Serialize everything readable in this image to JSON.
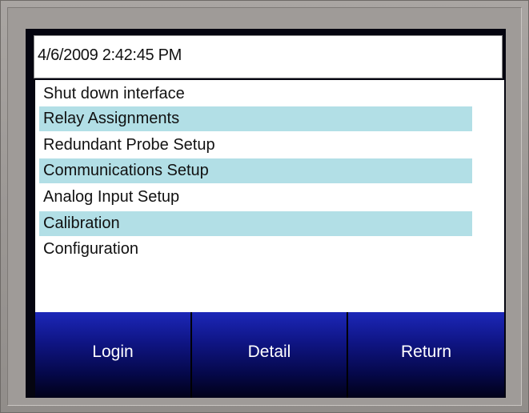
{
  "header": {
    "datetime": "4/6/2009 2:42:45 PM"
  },
  "menu": {
    "items": [
      {
        "label": "Shut down interface",
        "highlighted": false
      },
      {
        "label": "Relay Assignments",
        "highlighted": true
      },
      {
        "label": "Redundant Probe Setup",
        "highlighted": false
      },
      {
        "label": "Communications Setup",
        "highlighted": true
      },
      {
        "label": "Analog Input Setup",
        "highlighted": false
      },
      {
        "label": "Calibration",
        "highlighted": true
      },
      {
        "label": "Configuration",
        "highlighted": false
      }
    ]
  },
  "buttons": {
    "login": "Login",
    "detail": "Detail",
    "return": "Return"
  },
  "colors": {
    "row_highlight": "#b2dfe6",
    "button_blue": "#0f1585",
    "bezel": "#9f9b98"
  }
}
